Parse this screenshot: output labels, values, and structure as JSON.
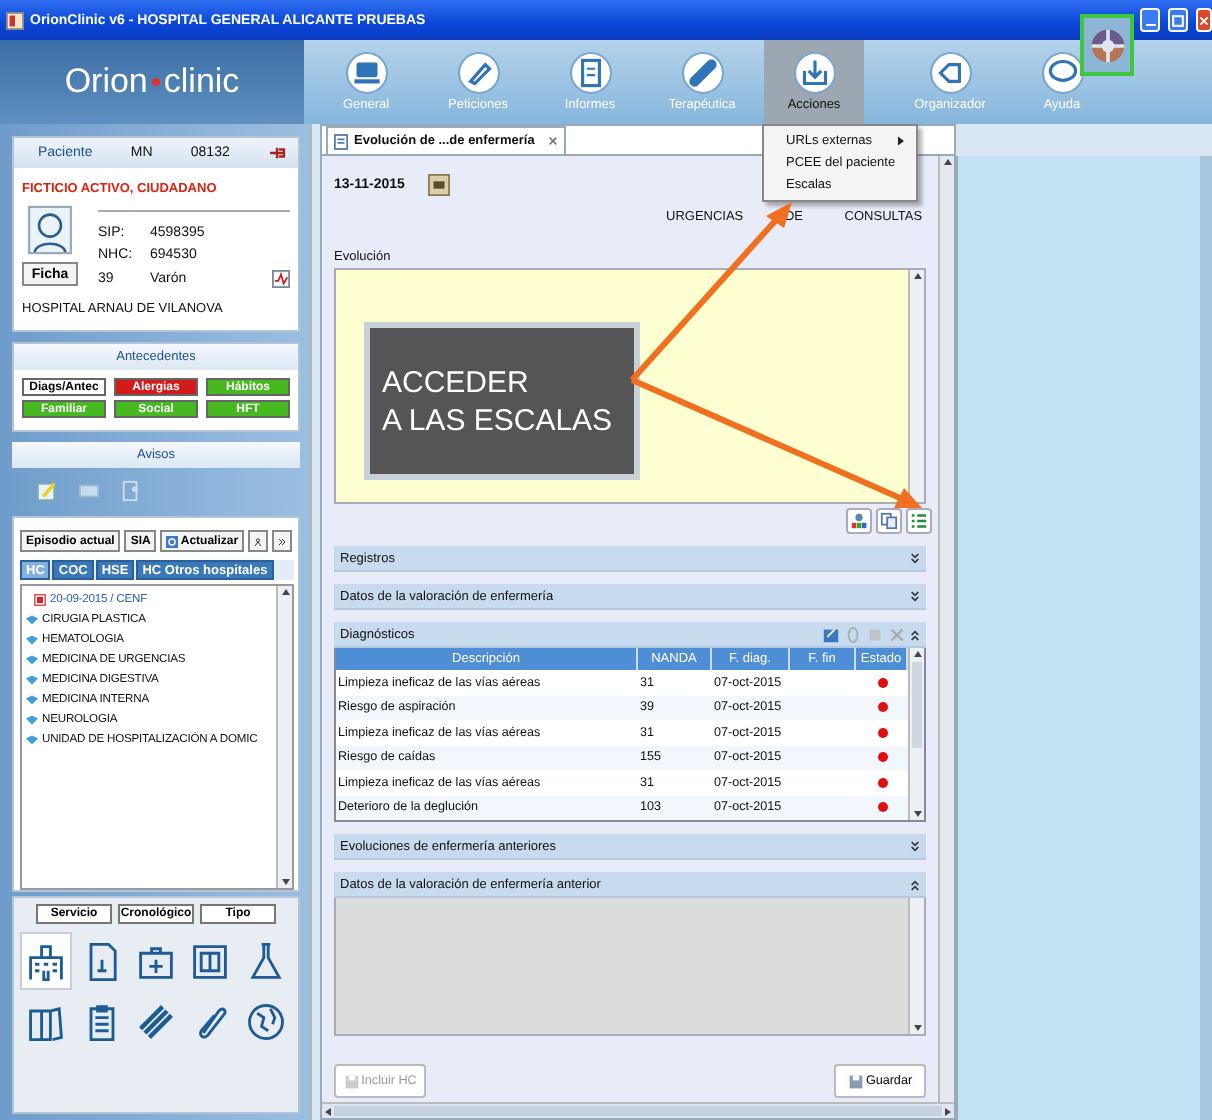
{
  "window": {
    "title": "OrionClinic v6 - HOSPITAL GENERAL ALICANTE PRUEBAS"
  },
  "logo": {
    "first": "Orion",
    "second": "clinic"
  },
  "toolbar": [
    {
      "label": "General",
      "selected": false
    },
    {
      "label": "Peticiones",
      "selected": false
    },
    {
      "label": "Informes",
      "selected": false
    },
    {
      "label": "Terapéutica",
      "selected": false
    },
    {
      "label": "Acciones",
      "selected": true
    },
    {
      "label": "Organizador",
      "selected": false
    },
    {
      "label": "Ayuda",
      "selected": false
    }
  ],
  "actions_menu": [
    {
      "label": "URLs externas",
      "submenu": true
    },
    {
      "label": "PCEE del paciente",
      "submenu": false
    },
    {
      "label": "Escalas",
      "submenu": false
    }
  ],
  "patient": {
    "header": [
      "Paciente",
      "MN",
      "08132"
    ],
    "name": "FICTICIO ACTIVO, CIUDADANO",
    "card_button": "Ficha",
    "fields": [
      {
        "label": "SIP:",
        "value": "4598395"
      },
      {
        "label": "NHC:",
        "value": "694530"
      },
      {
        "label": "39",
        "value": "Varón"
      }
    ],
    "hospital": "HOSPITAL ARNAU DE VILANOVA"
  },
  "antecedentes": {
    "title": "Antecedentes",
    "buttons": [
      {
        "label": "Diags/Antec",
        "color": "#ffffff"
      },
      {
        "label": "Alergias",
        "color": "#d21c1c"
      },
      {
        "label": "Hábitos",
        "color": "#46b820"
      },
      {
        "label": "Familiar",
        "color": "#46b820"
      },
      {
        "label": "Social",
        "color": "#46b820"
      },
      {
        "label": "HFT",
        "color": "#46b820"
      }
    ]
  },
  "avisos": {
    "title": "Avisos"
  },
  "episodes": {
    "buttons": [
      "Episodio actual",
      "SIA",
      "Actualizar"
    ],
    "tabs": [
      {
        "label": "HC",
        "selected": true
      },
      {
        "label": "COC",
        "selected": false
      },
      {
        "label": "HSE",
        "selected": false
      },
      {
        "label": "HC Otros hospitales",
        "selected": false
      }
    ],
    "tree": [
      {
        "label": "20-09-2015 / CENF",
        "kind": "episode"
      },
      {
        "label": "CIRUGIA PLASTICA",
        "kind": "service"
      },
      {
        "label": "HEMATOLOGIA",
        "kind": "service"
      },
      {
        "label": "MEDICINA DE URGENCIAS",
        "kind": "service"
      },
      {
        "label": "MEDICINA DIGESTIVA",
        "kind": "service"
      },
      {
        "label": "MEDICINA INTERNA",
        "kind": "service"
      },
      {
        "label": "NEUROLOGIA",
        "kind": "service"
      },
      {
        "label": "UNIDAD DE HOSPITALIZACIÓN A DOMIC",
        "kind": "service"
      }
    ],
    "sort_buttons": [
      "Servicio",
      "Cronológico",
      "Tipo"
    ]
  },
  "view_icons": [
    {
      "selected": true
    },
    {
      "selected": false
    },
    {
      "selected": false
    },
    {
      "selected": false
    },
    {
      "selected": false
    },
    {
      "selected": false
    },
    {
      "selected": false
    },
    {
      "selected": false
    },
    {
      "selected": false
    },
    {
      "selected": false
    }
  ],
  "document": {
    "tab": "Evolución de ...de enfermería",
    "date": "13-11-2015",
    "location": "URGENCIAS DE CONSULTAS",
    "evolution_label": "Evolución",
    "callout": [
      "ACCEDER",
      "A LAS ESCALAS"
    ],
    "sections": [
      {
        "title": "Registros",
        "expanded": false,
        "kind": "none"
      },
      {
        "title": "Datos de la valoración de enfermería",
        "expanded": false,
        "kind": "none"
      },
      {
        "title": "Diagnósticos",
        "expanded": true,
        "kind": "table"
      },
      {
        "title": "Evoluciones de enfermería anteriores",
        "expanded": false,
        "kind": "none"
      },
      {
        "title": "Datos de la valoración de enfermería anterior",
        "expanded": true,
        "kind": "empty"
      }
    ],
    "table": {
      "columns": [
        "Descripción",
        "NANDA",
        "F. diag.",
        "F. fin",
        "Estado"
      ],
      "rows": [
        {
          "description": "Limpieza ineficaz de las vías aéreas",
          "nanda": "31",
          "date": "07-oct-2015",
          "color": "#e01010"
        },
        {
          "description": "Riesgo de aspiración",
          "nanda": "39",
          "date": "07-oct-2015",
          "color": "#e01010"
        },
        {
          "description": "Limpieza ineficaz de las vías aéreas",
          "nanda": "31",
          "date": "07-oct-2015",
          "color": "#e01010"
        },
        {
          "description": "Riesgo de caídas",
          "nanda": "155",
          "date": "07-oct-2015",
          "color": "#e01010"
        },
        {
          "description": "Limpieza ineficaz de las vías aéreas",
          "nanda": "31",
          "date": "07-oct-2015",
          "color": "#e01010"
        },
        {
          "description": "Deterioro de la deglución",
          "nanda": "103",
          "date": "07-oct-2015",
          "color": "#e01010"
        }
      ]
    },
    "buttons": [
      {
        "label": "Incluir HC",
        "disabled": true
      },
      {
        "label": "Guardar",
        "disabled": false
      }
    ]
  }
}
